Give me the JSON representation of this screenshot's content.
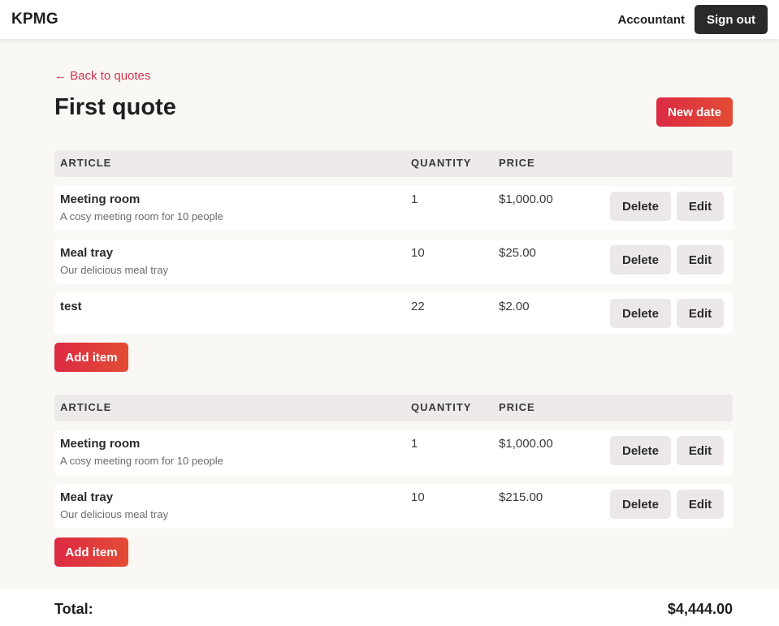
{
  "navbar": {
    "brand": "KPMG",
    "user": "Accountant",
    "sign_out": "Sign out"
  },
  "page": {
    "back_link": "← Back to quotes",
    "title": "First quote",
    "new_date": "New date"
  },
  "headers": {
    "article": "ARTICLE",
    "quantity": "QUANTITY",
    "price": "PRICE"
  },
  "tables": [
    {
      "rows": [
        {
          "name": "Meeting room",
          "description": "A cosy meeting room for 10 people",
          "quantity": "1",
          "price": "$1,000.00"
        },
        {
          "name": "Meal tray",
          "description": "Our delicious meal tray",
          "quantity": "10",
          "price": "$25.00"
        },
        {
          "name": "test",
          "description": "",
          "quantity": "22",
          "price": "$2.00"
        }
      ]
    },
    {
      "rows": [
        {
          "name": "Meeting room",
          "description": "A cosy meeting room for 10 people",
          "quantity": "1",
          "price": "$1,000.00"
        },
        {
          "name": "Meal tray",
          "description": "Our delicious meal tray",
          "quantity": "10",
          "price": "$215.00"
        }
      ]
    }
  ],
  "actions": {
    "delete": "Delete",
    "edit": "Edit",
    "add_item": "Add item"
  },
  "footer": {
    "total_label": "Total:",
    "total_value": "$4,444.00"
  },
  "colors": {
    "accent": "#dc2a43",
    "accent_end": "#e24c34",
    "dark_button": "#2a2a2a",
    "background": "#faf8f5"
  }
}
